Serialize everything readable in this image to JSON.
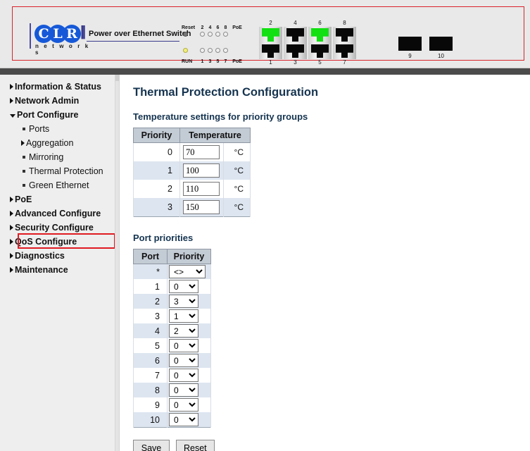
{
  "device": {
    "logo": {
      "letters": [
        "C",
        "L",
        "R"
      ],
      "subtext": "n e t w o r k s",
      "slashes": "||"
    },
    "title": "Power over Ethernet Switch",
    "leds": {
      "top_labels": [
        "Reset",
        "2",
        "4",
        "6",
        "8",
        "PoE"
      ],
      "bottom_labels": [
        "RUN",
        "1",
        "3",
        "5",
        "7",
        "PoE"
      ],
      "reset_color": "#787878",
      "run_color": "#f2f07a"
    },
    "rj45_ports": [
      {
        "top_num": "2",
        "bottom_num": "1",
        "top_active": true,
        "bottom_active": false
      },
      {
        "top_num": "4",
        "bottom_num": "3",
        "top_active": false,
        "bottom_active": false
      },
      {
        "top_num": "6",
        "bottom_num": "5",
        "top_active": true,
        "bottom_active": false
      },
      {
        "top_num": "8",
        "bottom_num": "7",
        "top_active": false,
        "bottom_active": false
      }
    ],
    "sfp_ports": [
      {
        "num": "9"
      },
      {
        "num": "10"
      }
    ],
    "frame_color": "#d9232b"
  },
  "sidebar": {
    "items": [
      {
        "label": "Information & Status",
        "marker": "triangle-right",
        "level": 0
      },
      {
        "label": "Network Admin",
        "marker": "triangle-right",
        "level": 0
      },
      {
        "label": "Port Configure",
        "marker": "triangle-down",
        "level": 0
      },
      {
        "label": "Ports",
        "marker": "square-bullet",
        "level": 1
      },
      {
        "label": "Aggregation",
        "marker": "triangle-right",
        "level": 1
      },
      {
        "label": "Mirroring",
        "marker": "square-bullet",
        "level": 1
      },
      {
        "label": "Thermal Protection",
        "marker": "square-bullet",
        "level": 1
      },
      {
        "label": "Green Ethernet",
        "marker": "square-bullet",
        "level": 1
      },
      {
        "label": "PoE",
        "marker": "triangle-right",
        "level": 0
      },
      {
        "label": "Advanced Configure",
        "marker": "triangle-right",
        "level": 0
      },
      {
        "label": "Security Configure",
        "marker": "triangle-right",
        "level": 0
      },
      {
        "label": "QoS Configure",
        "marker": "triangle-right",
        "level": 0
      },
      {
        "label": "Diagnostics",
        "marker": "triangle-right",
        "level": 0
      },
      {
        "label": "Maintenance",
        "marker": "triangle-right",
        "level": 0
      }
    ],
    "highlighted_item": "Thermal Protection",
    "highlight_color": "#e01b22"
  },
  "main": {
    "page_title": "Thermal Protection Configuration",
    "temperature_section": {
      "heading": "Temperature settings for priority groups",
      "columns": [
        "Priority",
        "Temperature"
      ],
      "unit": "°C",
      "rows": [
        {
          "priority": "0",
          "temperature": "70"
        },
        {
          "priority": "1",
          "temperature": "100"
        },
        {
          "priority": "2",
          "temperature": "110"
        },
        {
          "priority": "3",
          "temperature": "150"
        }
      ]
    },
    "port_section": {
      "heading": "Port priorities",
      "columns": [
        "Port",
        "Priority"
      ],
      "options": [
        "0",
        "1",
        "2",
        "3"
      ],
      "wildcard_option": "<>",
      "rows": [
        {
          "port": "*",
          "priority": "<>"
        },
        {
          "port": "1",
          "priority": "0"
        },
        {
          "port": "2",
          "priority": "3"
        },
        {
          "port": "3",
          "priority": "1"
        },
        {
          "port": "4",
          "priority": "2"
        },
        {
          "port": "5",
          "priority": "0"
        },
        {
          "port": "6",
          "priority": "0"
        },
        {
          "port": "7",
          "priority": "0"
        },
        {
          "port": "8",
          "priority": "0"
        },
        {
          "port": "9",
          "priority": "0"
        },
        {
          "port": "10",
          "priority": "0"
        }
      ]
    },
    "buttons": {
      "save": "Save",
      "reset": "Reset"
    }
  }
}
